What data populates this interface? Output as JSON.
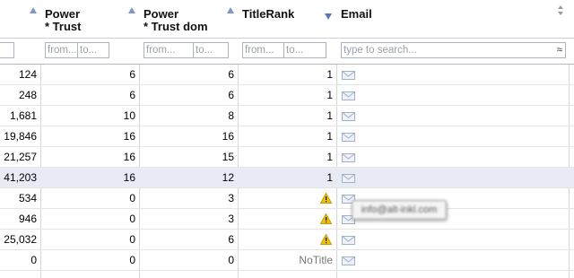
{
  "columns": {
    "power_trust": {
      "title_line1": "Power",
      "title_line2": "* Trust"
    },
    "power_trust_dom": {
      "title_line1": "Power",
      "title_line2": "* Trust dom"
    },
    "title_rank": {
      "title": "TitleRank"
    },
    "email": {
      "title": "Email"
    }
  },
  "filters": {
    "from": "from...",
    "to": "to...",
    "email_placeholder": "type to search...",
    "clear_glyph": "≈"
  },
  "rows": [
    {
      "c1": "124",
      "c2": "6",
      "c3": "6",
      "c4": "1",
      "c4_warn": false
    },
    {
      "c1": "248",
      "c2": "6",
      "c3": "6",
      "c4": "1",
      "c4_warn": false
    },
    {
      "c1": "1,681",
      "c2": "10",
      "c3": "8",
      "c4": "1",
      "c4_warn": false
    },
    {
      "c1": "19,846",
      "c2": "16",
      "c3": "16",
      "c4": "1",
      "c4_warn": false
    },
    {
      "c1": "21,257",
      "c2": "16",
      "c3": "15",
      "c4": "1",
      "c4_warn": false
    },
    {
      "c1": "41,203",
      "c2": "16",
      "c3": "12",
      "c4": "1",
      "c4_warn": false,
      "selected": true
    },
    {
      "c1": "534",
      "c2": "0",
      "c3": "3",
      "c4": "",
      "c4_warn": true
    },
    {
      "c1": "946",
      "c2": "0",
      "c3": "3",
      "c4": "",
      "c4_warn": true
    },
    {
      "c1": "25,032",
      "c2": "0",
      "c3": "6",
      "c4": "",
      "c4_warn": true
    },
    {
      "c1": "0",
      "c2": "0",
      "c3": "0",
      "c4": "NoTitle",
      "c4_warn": false
    }
  ],
  "tooltip": {
    "text": "info@alt-inkl.com"
  },
  "colors": {
    "accent": "#5577c2",
    "selected_row": "#e8ebf4",
    "warning": "#f2c200"
  }
}
